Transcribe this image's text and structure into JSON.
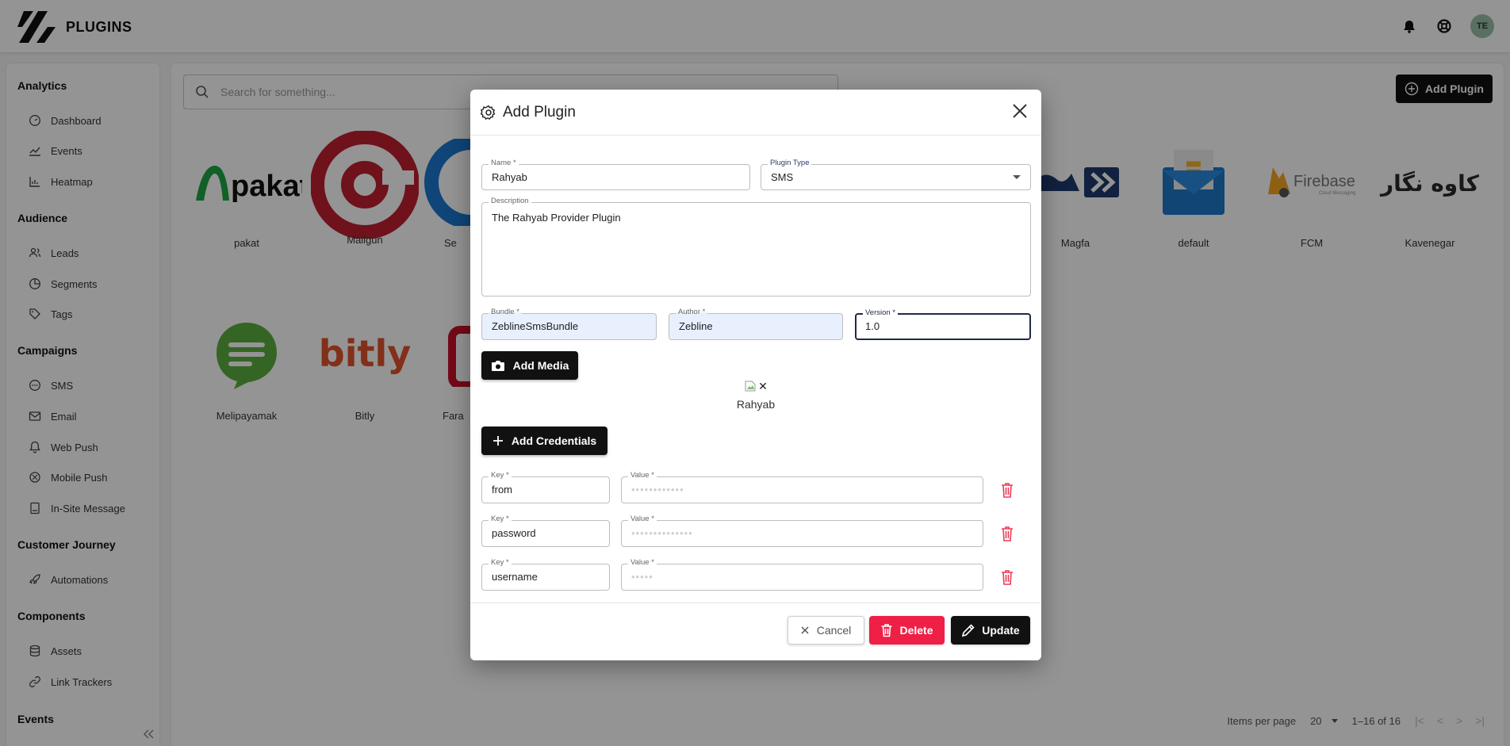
{
  "app": {
    "title": "PLUGINS",
    "avatar_initials": "TE"
  },
  "sidebar": {
    "sections": [
      {
        "title": "Analytics",
        "items": [
          {
            "label": "Dashboard",
            "icon": "gauge-icon"
          },
          {
            "label": "Events",
            "icon": "line-chart-icon"
          },
          {
            "label": "Heatmap",
            "icon": "bar-chart-icon"
          }
        ]
      },
      {
        "title": "Audience",
        "items": [
          {
            "label": "Leads",
            "icon": "users-icon"
          },
          {
            "label": "Segments",
            "icon": "pie-chart-icon"
          },
          {
            "label": "Tags",
            "icon": "tag-icon"
          }
        ]
      },
      {
        "title": "Campaigns",
        "items": [
          {
            "label": "SMS",
            "icon": "chat-icon"
          },
          {
            "label": "Email",
            "icon": "mail-icon"
          },
          {
            "label": "Web Push",
            "icon": "bell-icon"
          },
          {
            "label": "Mobile Push",
            "icon": "mobile-push-icon"
          },
          {
            "label": "In-Site Message",
            "icon": "message-square-icon"
          }
        ]
      },
      {
        "title": "Customer Journey",
        "items": [
          {
            "label": "Automations",
            "icon": "rocket-icon"
          }
        ]
      },
      {
        "title": "Components",
        "items": [
          {
            "label": "Assets",
            "icon": "database-icon"
          },
          {
            "label": "Link Trackers",
            "icon": "link-icon"
          }
        ]
      },
      {
        "title": "Events",
        "items": []
      }
    ]
  },
  "main": {
    "search_placeholder": "Search for something...",
    "add_plugin_label": "Add Plugin",
    "plugins": [
      {
        "name": "pakat"
      },
      {
        "name": "Mailgun"
      },
      {
        "name": "Se"
      },
      {
        "name": "Magfa"
      },
      {
        "name": "default"
      },
      {
        "name": "FCM"
      },
      {
        "name": "Kavenegar"
      },
      {
        "name": "Melipayamak"
      },
      {
        "name": "Bitly"
      },
      {
        "name": "Fara"
      }
    ],
    "logos": {
      "pakat": "pakat",
      "bitly": "bitly",
      "firebase": "Firebase",
      "firebase_sub": "Cloud Messaging",
      "kavenegar": "کاوه نگار"
    },
    "pager": {
      "items_per_page_label": "Items per page",
      "items_per_page": "20",
      "range": "1–16 of 16"
    }
  },
  "dialog": {
    "title": "Add Plugin",
    "name": {
      "label": "Name *",
      "value": "Rahyab"
    },
    "plugin_type": {
      "label": "Plugin Type",
      "value": "SMS"
    },
    "description": {
      "label": "Description",
      "value": "The Rahyab Provider Plugin"
    },
    "bundle": {
      "label": "Bundle *",
      "value": "ZeblineSmsBundle"
    },
    "author": {
      "label": "Author *",
      "value": "Zebline"
    },
    "version": {
      "label": "Version *",
      "value": "1.0"
    },
    "add_media_label": "Add Media",
    "media_name": "Rahyab",
    "media_remove": "✕",
    "add_credentials_label": "Add Credentials",
    "credentials": [
      {
        "key_label": "Key *",
        "key": "from",
        "value_label": "Value *",
        "value": "••••••••••••"
      },
      {
        "key_label": "Key *",
        "key": "password",
        "value_label": "Value *",
        "value": "••••••••••••••"
      },
      {
        "key_label": "Key *",
        "key": "username",
        "value_label": "Value *",
        "value": "•••••"
      }
    ],
    "cancel_label": "Cancel",
    "delete_label": "Delete",
    "update_label": "Update"
  }
}
